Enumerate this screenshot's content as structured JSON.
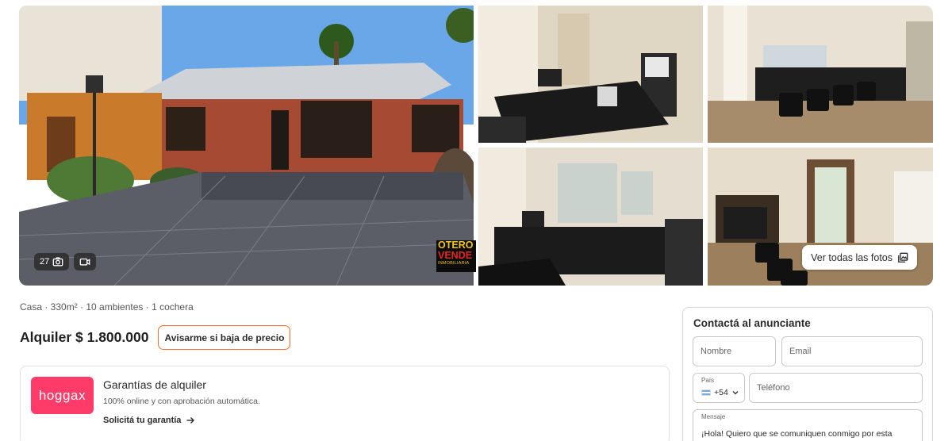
{
  "gallery": {
    "photo_count": "27",
    "see_all_label": "Ver todas las fotos",
    "watermark_line1": "OTERO",
    "watermark_line2": "VENDE",
    "watermark_line3": "INMOBILIARIA"
  },
  "listing": {
    "features": "Casa · 330m² · 10 ambientes · 1 cochera",
    "price": "Alquiler $ 1.800.000",
    "price_alert_label": "Avisarme si baja de precio"
  },
  "guarantee": {
    "logo_text": "hoggax",
    "title": "Garantías de alquiler",
    "description": "100% online y con aprobación automática.",
    "link_label": "Solicitá tu garantía"
  },
  "contact": {
    "title": "Contactá al anunciante",
    "name_placeholder": "Nombre",
    "email_placeholder": "Email",
    "country_label": "País",
    "country_code": "+54",
    "phone_placeholder": "Teléfono",
    "message_label": "Mensaje",
    "message_text": "¡Hola! Quiero que se comuniquen conmigo por esta"
  },
  "colors": {
    "accent_orange": "#ff6b2c",
    "hoggax_pink": "#ff3b6a"
  },
  "icons": [
    "camera-icon",
    "video-icon",
    "gallery-icon",
    "arrow-right-icon",
    "chevron-down-icon",
    "argentina-flag-icon"
  ]
}
